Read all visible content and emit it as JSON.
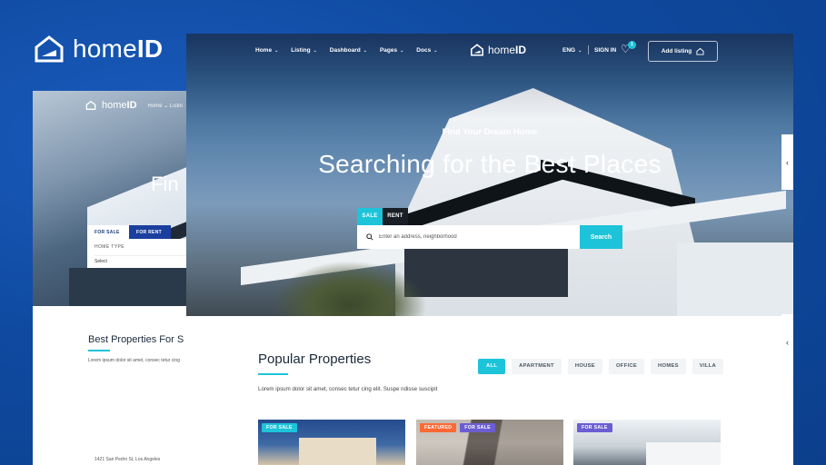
{
  "brand": {
    "name_regular": "home",
    "name_bold": "ID"
  },
  "back_page": {
    "logo_regular": "home",
    "logo_bold": "ID",
    "menu": "Home ⌄  Listin",
    "hero_text": "Fin",
    "tabs": [
      "FOR SALE",
      "FOR RENT"
    ],
    "home_type_label": "HOME TYPE",
    "select_value": "Select",
    "section_title": "Best Properties For S",
    "section_desc": "Lorem ipsum dolor sit amet, consec tetur cing",
    "address": "1421 San Pedro St, Los Angeles"
  },
  "nav": {
    "items": [
      {
        "label": "Home"
      },
      {
        "label": "Listing"
      },
      {
        "label": "Dashboard"
      },
      {
        "label": "Pages"
      },
      {
        "label": "Docs"
      }
    ],
    "logo_regular": "home",
    "logo_bold": "ID",
    "language": "ENG",
    "signin": "SIGN IN",
    "wishlist_count": "1",
    "add_listing": "Add listing"
  },
  "hero": {
    "subtitle": "Find Your Dream Home",
    "title": "Searching for the Best Places",
    "tabs": [
      "SALE",
      "RENT"
    ],
    "search_placeholder": "Enter an address, neighborhood",
    "search_button": "Search"
  },
  "popular": {
    "title": "Popular Properties",
    "description": "Lorem ipsum dolor sit amet, consec tetur cing elit. Suspe ndisse suscipit",
    "filters": [
      "ALL",
      "APARTMENT",
      "HOUSE",
      "OFFICE",
      "HOMES",
      "VILLA"
    ],
    "cards": [
      {
        "badges": [
          "FOR SALE"
        ]
      },
      {
        "badges": [
          "FEATURED",
          "FOR SALE"
        ]
      },
      {
        "badges": [
          "FOR SALE"
        ]
      }
    ]
  },
  "colors": {
    "accent": "#1dc4d9",
    "background": "#0f4aa0",
    "featured": "#ff6935",
    "sale_purple": "#6c5dd3"
  },
  "icons": [
    "home-logo-icon",
    "chevron-down-icon",
    "heart-icon",
    "house-icon",
    "search-icon",
    "chevron-left-icon"
  ]
}
